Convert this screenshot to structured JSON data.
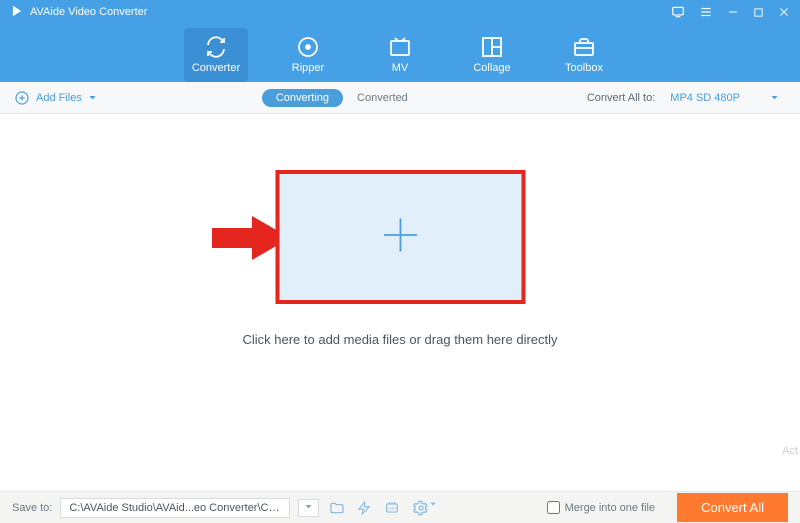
{
  "app": {
    "title": "AVAide Video Converter"
  },
  "tabs": {
    "converter": "Converter",
    "ripper": "Ripper",
    "mv": "MV",
    "collage": "Collage",
    "toolbox": "Toolbox"
  },
  "subbar": {
    "add_files": "Add Files",
    "converting": "Converting",
    "converted": "Converted",
    "convert_all_to": "Convert All to:",
    "format": "MP4 SD 480P"
  },
  "main": {
    "drop_hint": "Click here to add media files or drag them here directly"
  },
  "footer": {
    "save_to_label": "Save to:",
    "save_to_path": "C:\\AVAide Studio\\AVAid...eo Converter\\Converted",
    "merge_label": "Merge into one file",
    "convert_btn": "Convert All"
  },
  "watermark": "Act"
}
